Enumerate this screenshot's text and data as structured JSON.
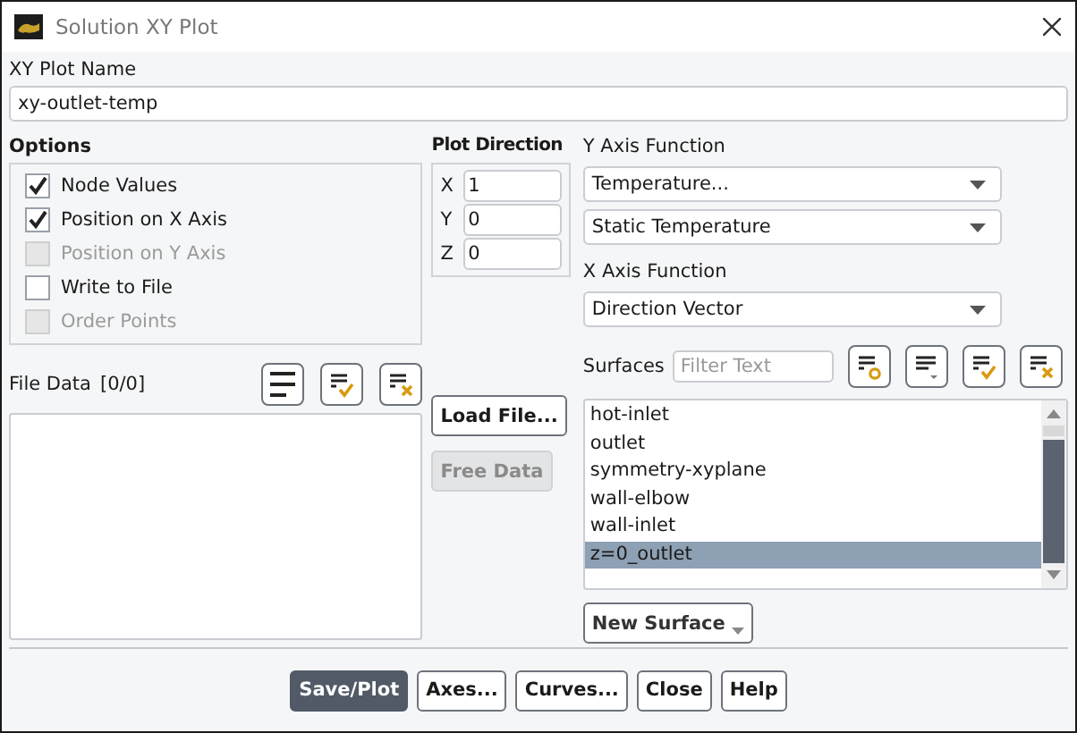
{
  "window": {
    "title": "Solution XY Plot"
  },
  "plot_name": {
    "label": "XY Plot Name",
    "value": "xy-outlet-temp"
  },
  "options": {
    "label": "Options",
    "items": [
      {
        "label": "Node Values",
        "checked": true,
        "disabled": false
      },
      {
        "label": "Position on X Axis",
        "checked": true,
        "disabled": false
      },
      {
        "label": "Position on Y Axis",
        "checked": false,
        "disabled": true
      },
      {
        "label": "Write to File",
        "checked": false,
        "disabled": false
      },
      {
        "label": "Order Points",
        "checked": false,
        "disabled": true
      }
    ]
  },
  "plot_direction": {
    "label": "Plot Direction",
    "fields": [
      {
        "axis": "X",
        "value": "1"
      },
      {
        "axis": "Y",
        "value": "0"
      },
      {
        "axis": "Z",
        "value": "0"
      }
    ]
  },
  "y_axis_function": {
    "label": "Y Axis Function",
    "dropdowns": [
      "Temperature...",
      "Static Temperature"
    ]
  },
  "x_axis_function": {
    "label": "X Axis Function",
    "dropdowns": [
      "Direction Vector"
    ]
  },
  "file_data": {
    "label": "File Data",
    "count": "[0/0]",
    "tools": [
      {
        "kind": "all"
      },
      {
        "kind": "check"
      },
      {
        "kind": "clear"
      }
    ]
  },
  "file_buttons": [
    {
      "label": "Load File...",
      "disabled": false
    },
    {
      "label": "Free Data",
      "disabled": true
    }
  ],
  "surfaces": {
    "label": "Surfaces",
    "filter_placeholder": "Filter Text",
    "tools": [
      {
        "kind": "circle"
      },
      {
        "kind": "menu"
      },
      {
        "kind": "check"
      },
      {
        "kind": "clear"
      }
    ],
    "items": [
      {
        "label": "hot-inlet",
        "selected": false
      },
      {
        "label": "outlet",
        "selected": false
      },
      {
        "label": "symmetry-xyplane",
        "selected": false
      },
      {
        "label": "wall-elbow",
        "selected": false
      },
      {
        "label": "wall-inlet",
        "selected": false
      },
      {
        "label": "z=0_outlet",
        "selected": true
      }
    ],
    "new_surface": "New Surface"
  },
  "buttons": [
    {
      "label": "Save/Plot",
      "primary": true
    },
    {
      "label": "Axes...",
      "primary": false
    },
    {
      "label": "Curves...",
      "primary": false
    },
    {
      "label": "Close",
      "primary": false
    },
    {
      "label": "Help",
      "primary": false
    }
  ]
}
